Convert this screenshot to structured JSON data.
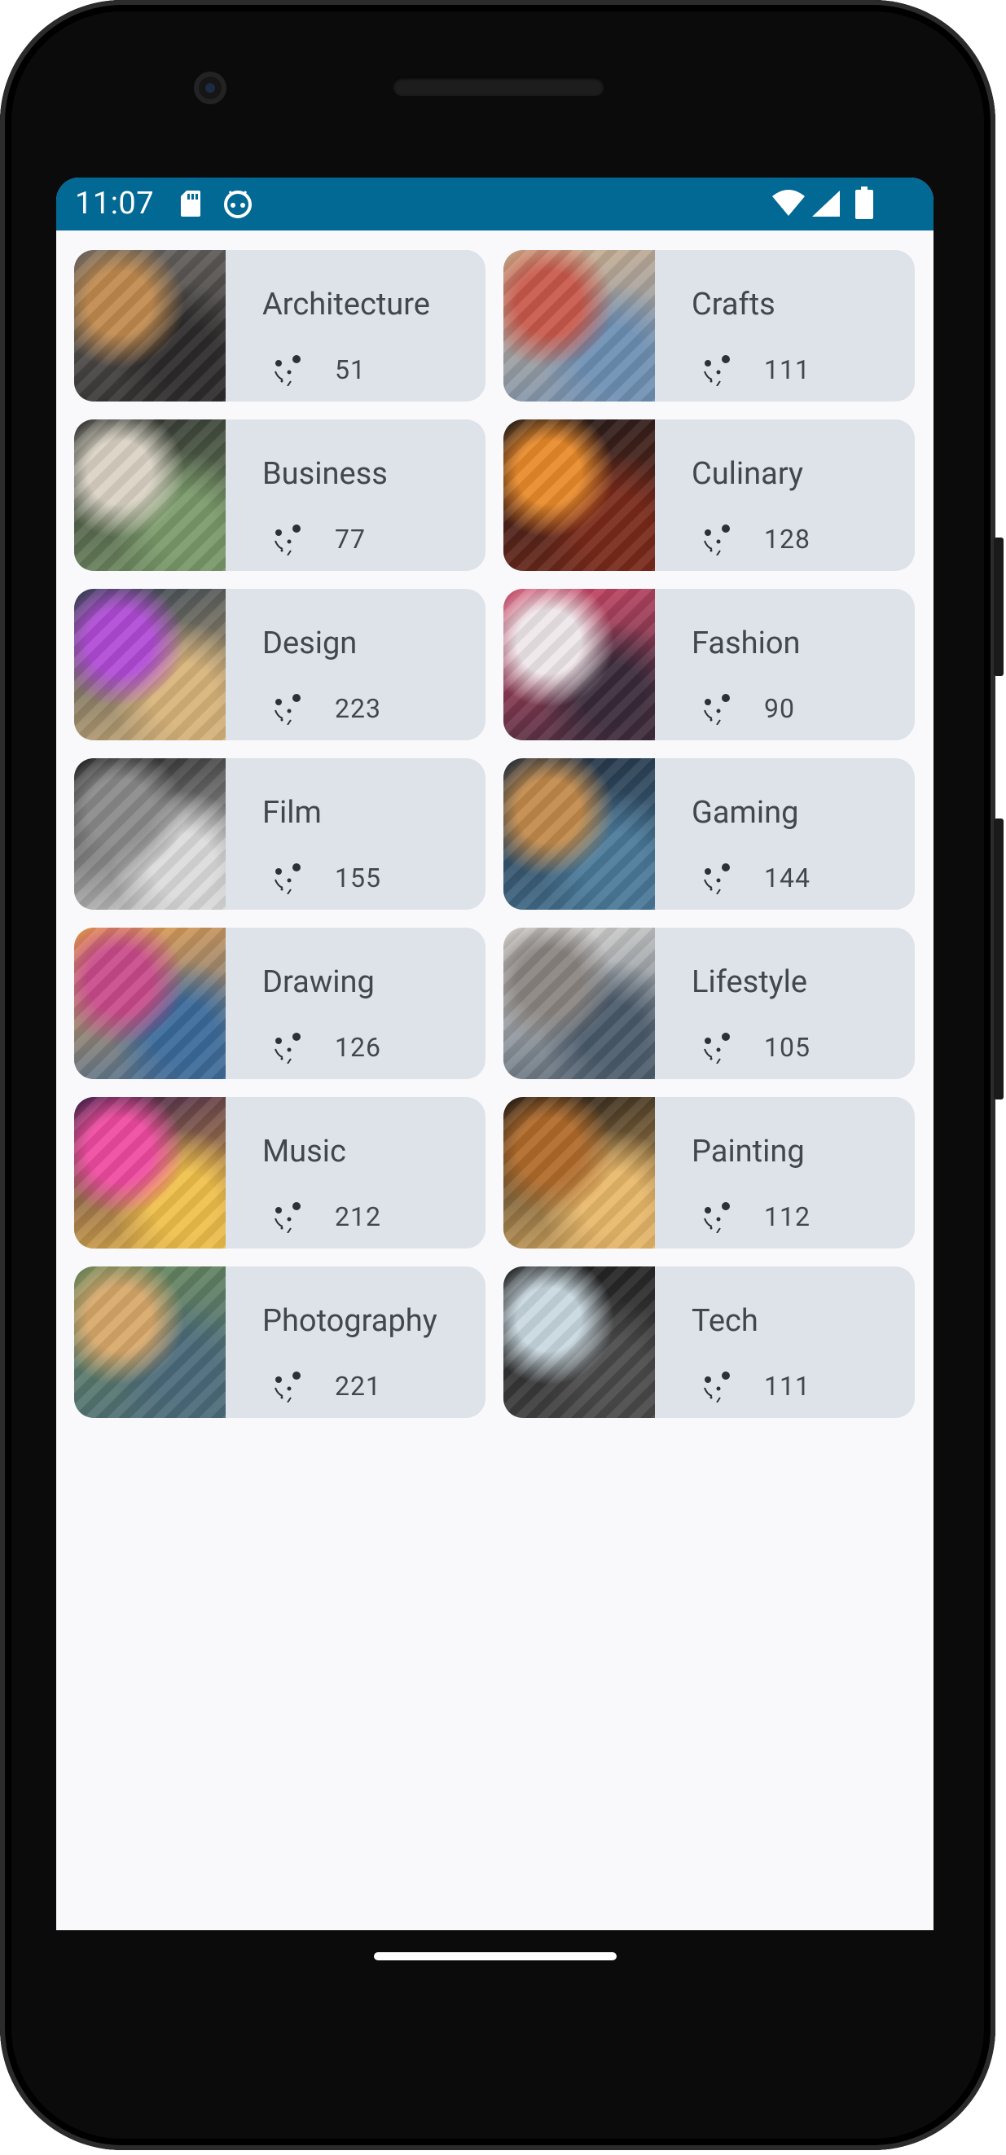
{
  "status_bar": {
    "time": "11:07",
    "background": "#026894",
    "icons": [
      "sd-card-icon",
      "robot-icon",
      "wifi-icon",
      "signal-icon",
      "battery-icon"
    ]
  },
  "theme": {
    "card_background": "#dde3e9",
    "text_color": "#42474e",
    "screen_background": "#f9f9fc"
  },
  "categories": [
    {
      "title": "Architecture",
      "count": "51",
      "icon": "sparkles-icon",
      "thumb_colors": [
        "#6e6a66",
        "#c08a4e",
        "#2c2a2a"
      ]
    },
    {
      "title": "Crafts",
      "count": "111",
      "icon": "sparkles-icon",
      "thumb_colors": [
        "#d7b38c",
        "#c8584a",
        "#6d8fb4"
      ]
    },
    {
      "title": "Business",
      "count": "77",
      "icon": "sparkles-icon",
      "thumb_colors": [
        "#2b2b2b",
        "#d9d2c4",
        "#7a9a6a"
      ]
    },
    {
      "title": "Culinary",
      "count": "128",
      "icon": "sparkles-icon",
      "thumb_colors": [
        "#1c1a1a",
        "#e88a2a",
        "#7a2a1a"
      ]
    },
    {
      "title": "Design",
      "count": "223",
      "icon": "sparkles-icon",
      "thumb_colors": [
        "#2c3e50",
        "#b04ad6",
        "#d8b47a"
      ]
    },
    {
      "title": "Fashion",
      "count": "90",
      "icon": "sparkles-icon",
      "thumb_colors": [
        "#d94a6a",
        "#efe7ea",
        "#3a2a3a"
      ]
    },
    {
      "title": "Film",
      "count": "155",
      "icon": "sparkles-icon",
      "thumb_colors": [
        "#1a1a1a",
        "#8a8a8a",
        "#dcdcdc"
      ]
    },
    {
      "title": "Gaming",
      "count": "144",
      "icon": "sparkles-icon",
      "thumb_colors": [
        "#1f2a3a",
        "#c28a4a",
        "#4a7a9a"
      ]
    },
    {
      "title": "Drawing",
      "count": "126",
      "icon": "sparkles-icon",
      "thumb_colors": [
        "#f4a24a",
        "#c84a8a",
        "#3a6a9a"
      ]
    },
    {
      "title": "Lifestyle",
      "count": "105",
      "icon": "sparkles-icon",
      "thumb_colors": [
        "#e8e4df",
        "#8a8480",
        "#4a5a6a"
      ]
    },
    {
      "title": "Music",
      "count": "212",
      "icon": "sparkles-icon",
      "thumb_colors": [
        "#3a1a4a",
        "#f04aa0",
        "#f0c04a"
      ]
    },
    {
      "title": "Painting",
      "count": "112",
      "icon": "sparkles-icon",
      "thumb_colors": [
        "#1a1410",
        "#b06a2a",
        "#e8b86a"
      ]
    },
    {
      "title": "Photography",
      "count": "221",
      "icon": "sparkles-icon",
      "thumb_colors": [
        "#6a8a5a",
        "#d8a86a",
        "#4a6a7a"
      ]
    },
    {
      "title": "Tech",
      "count": "111",
      "icon": "sparkles-icon",
      "thumb_colors": [
        "#1a1a1a",
        "#c8d8e0",
        "#4a4a4a"
      ]
    }
  ]
}
